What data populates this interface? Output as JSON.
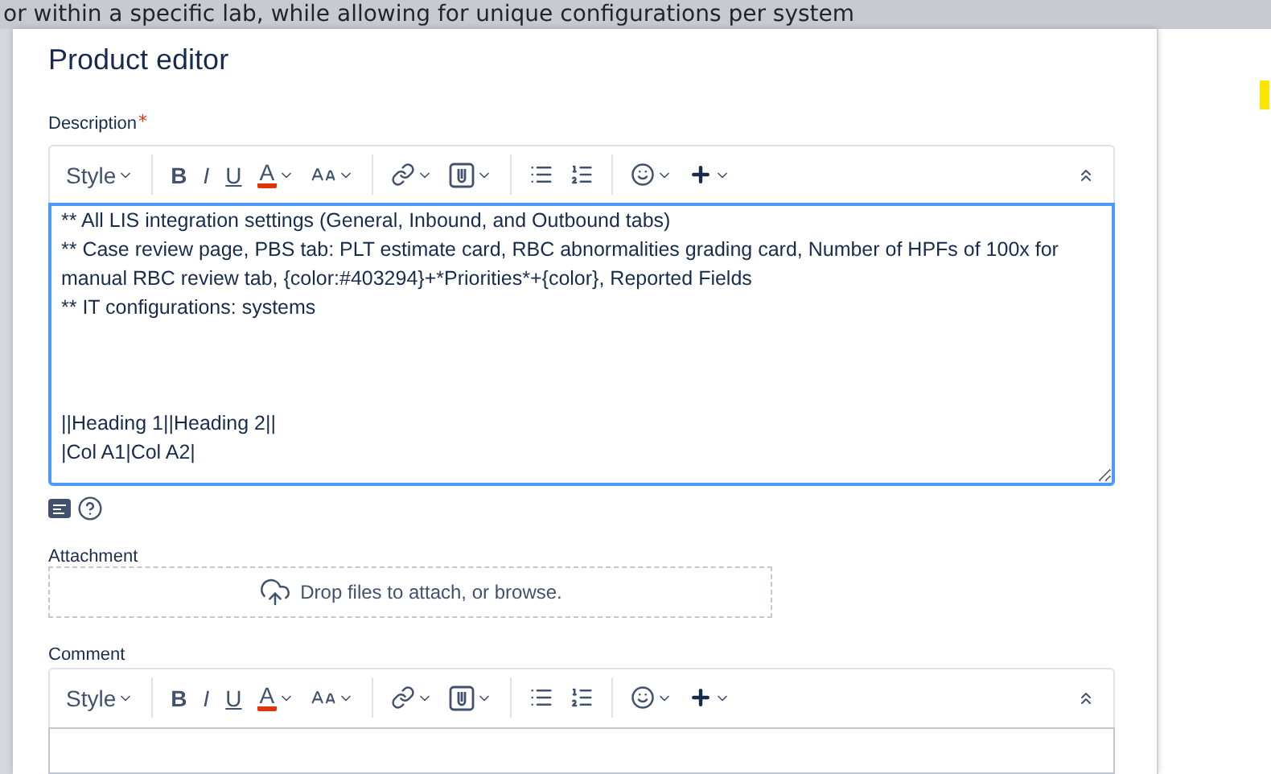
{
  "backdrop": {
    "text": "or within a specific lab, while allowing for unique configurations per system"
  },
  "dialog": {
    "title": "Product editor",
    "description": {
      "label": "Description",
      "required_mark": "*",
      "toolbar": [
        {
          "kind": "style",
          "label": "Style",
          "menu": true
        },
        {
          "kind": "separator"
        },
        {
          "kind": "bold",
          "label": "B"
        },
        {
          "kind": "italic",
          "label": "I"
        },
        {
          "kind": "underline",
          "label": "U"
        },
        {
          "kind": "text-color",
          "label": "A",
          "menu": true
        },
        {
          "kind": "text-size",
          "menu": true
        },
        {
          "kind": "separator"
        },
        {
          "kind": "link",
          "menu": true
        },
        {
          "kind": "attachment",
          "menu": true
        },
        {
          "kind": "separator"
        },
        {
          "kind": "bullet-list"
        },
        {
          "kind": "numbered-list"
        },
        {
          "kind": "separator"
        },
        {
          "kind": "emoji",
          "menu": true
        },
        {
          "kind": "insert",
          "menu": true
        },
        {
          "kind": "collapse"
        }
      ],
      "value": "** All LIS integration settings (General, Inbound, and Outbound tabs)\n** Case review page, PBS tab: PLT estimate card, RBC abnormalities grading card, Number of HPFs of 100x for manual RBC review tab, {color:#403294}+*Priorities*+{color}, Reported Fields\n** IT configurations: systems\n\n\n\n||Heading 1||Heading 2||\n|Col A1|Col A2|\n",
      "focused": true
    },
    "attachment": {
      "label": "Attachment",
      "dropzone": "Drop files to attach, or browse."
    },
    "comment": {
      "label": "Comment",
      "toolbar": [
        {
          "kind": "style",
          "label": "Style",
          "menu": true
        },
        {
          "kind": "separator"
        },
        {
          "kind": "bold",
          "label": "B"
        },
        {
          "kind": "italic",
          "label": "I"
        },
        {
          "kind": "underline",
          "label": "U"
        },
        {
          "kind": "text-color",
          "label": "A",
          "menu": true
        },
        {
          "kind": "text-size",
          "menu": true
        },
        {
          "kind": "separator"
        },
        {
          "kind": "link",
          "menu": true
        },
        {
          "kind": "attachment",
          "menu": true
        },
        {
          "kind": "separator"
        },
        {
          "kind": "bullet-list"
        },
        {
          "kind": "numbered-list"
        },
        {
          "kind": "separator"
        },
        {
          "kind": "emoji",
          "menu": true
        },
        {
          "kind": "insert",
          "menu": true
        },
        {
          "kind": "collapse"
        }
      ],
      "focused": false
    }
  }
}
